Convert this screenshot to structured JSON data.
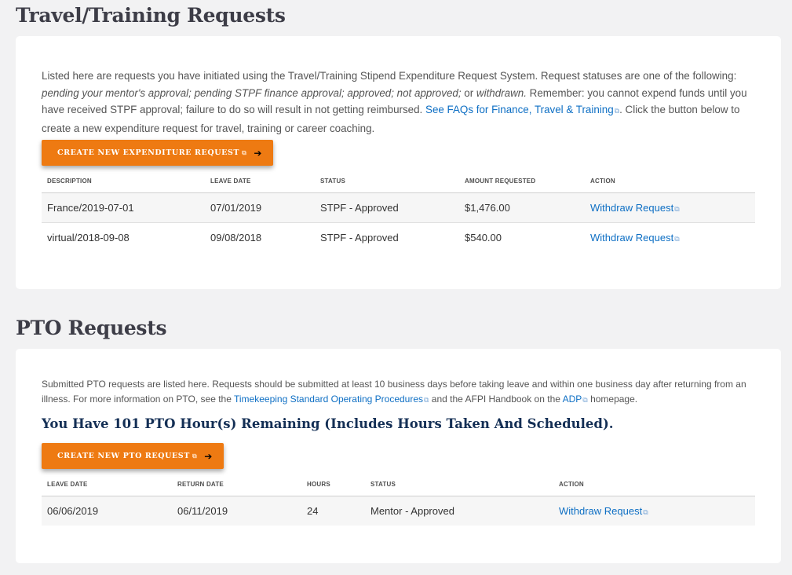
{
  "travel": {
    "title": "Travel/Training Requests",
    "intro": {
      "p1": "Listed here are requests you have initiated using the Travel/Training Stipend Expenditure Request System. Request statuses are one of the following: ",
      "statuses": "pending your mentor's approval; pending STPF finance approval; approved; not approved;",
      "or": " or ",
      "withdrawn": "withdrawn.",
      "p2": " Remember: you cannot expend funds until you have received STPF approval; failure to do so will result in not getting reimbursed. ",
      "faq_link": "See FAQs for Finance, Travel & Training",
      "p3": ". Click the button below to create a new expenditure request for travel, training or career coaching."
    },
    "button_label": "CREATE NEW EXPENDITURE REQUEST",
    "columns": [
      "DESCRIPTION",
      "LEAVE DATE",
      "STATUS",
      "AMOUNT REQUESTED",
      "ACTION"
    ],
    "rows": [
      {
        "description": "France/2019-07-01",
        "leave_date": "07/01/2019",
        "status": "STPF - Approved",
        "amount": "$1,476.00",
        "action": "Withdraw Request"
      },
      {
        "description": "virtual/2018-09-08",
        "leave_date": "09/08/2018",
        "status": "STPF - Approved",
        "amount": "$540.00",
        "action": "Withdraw Request"
      }
    ]
  },
  "pto": {
    "title": "PTO Requests",
    "intro": {
      "p1": "Submitted PTO requests are listed here. Requests should be submitted at least 10 business days before taking leave and within one business day after returning from an illness. For more information on PTO, see the ",
      "sop_link": "Timekeeping Standard Operating Procedures",
      "p2": " and the AFPI Handbook on the ",
      "adp_link": "ADP",
      "p3": " homepage."
    },
    "remaining_text": "You Have 101 PTO Hour(s) Remaining (Includes Hours Taken And Scheduled).",
    "button_label": "CREATE NEW PTO REQUEST",
    "columns": [
      "LEAVE DATE",
      "RETURN DATE",
      "HOURS",
      "STATUS",
      "ACTION"
    ],
    "rows": [
      {
        "leave_date": "06/06/2019",
        "return_date": "06/11/2019",
        "hours": "24",
        "status": "Mentor - Approved",
        "action": "Withdraw Request"
      }
    ]
  },
  "icons": {
    "external": "external-link-icon",
    "arrow": "arrow-right-icon"
  },
  "colors": {
    "accent_orange": "#ee7a12",
    "link_blue": "#0e6fc4",
    "heading_navy": "#142f55",
    "page_bg": "#f2f2f3"
  }
}
